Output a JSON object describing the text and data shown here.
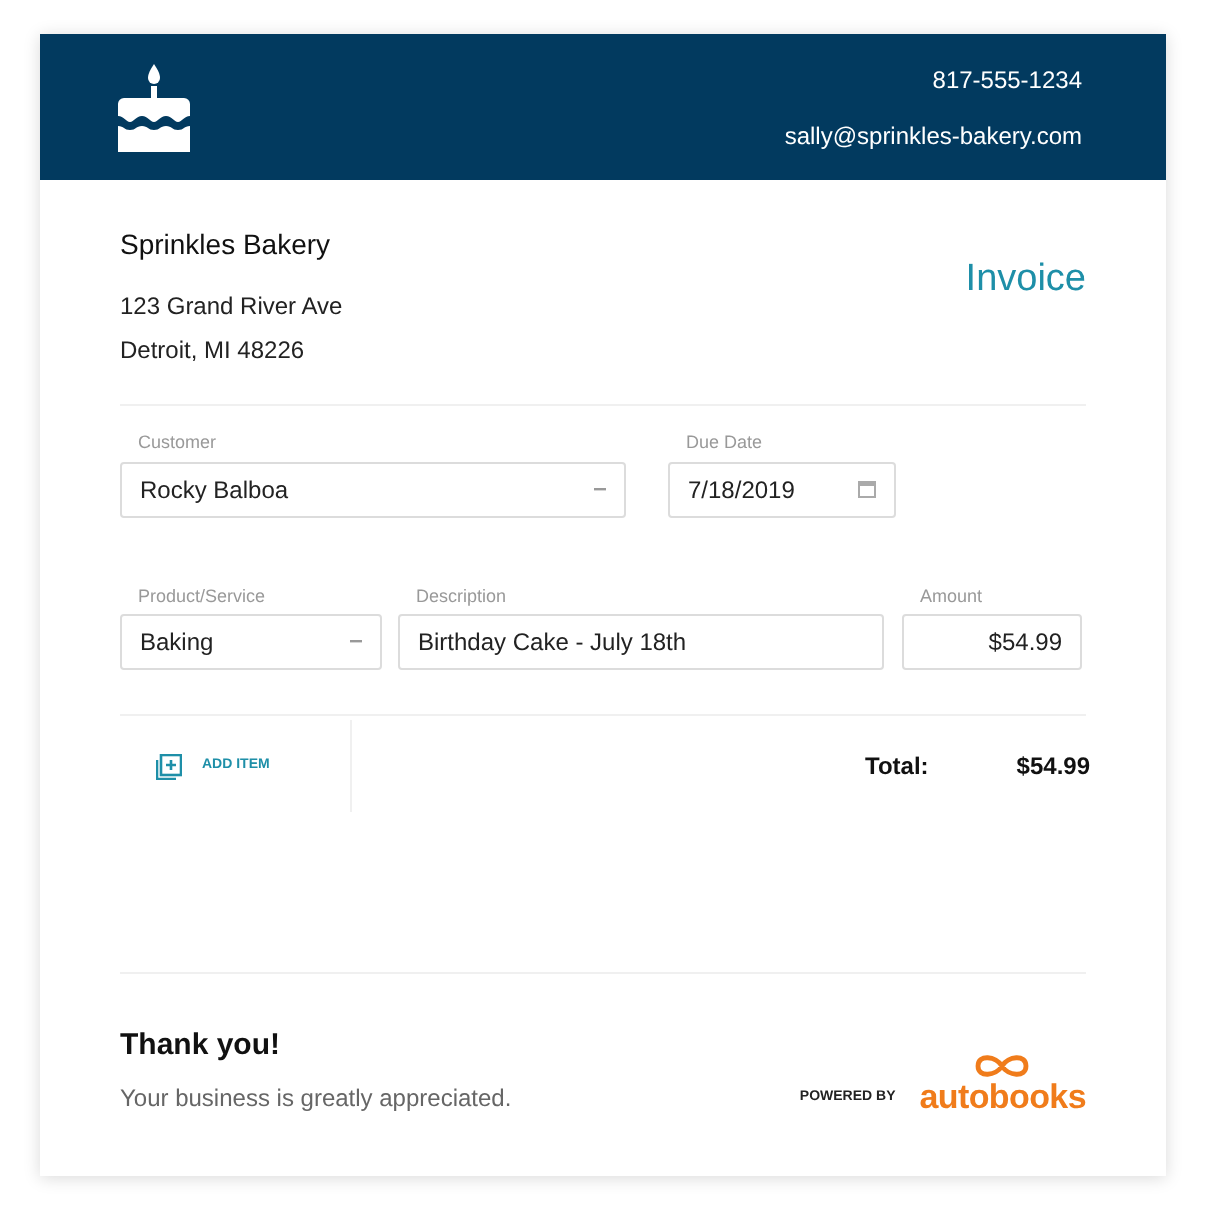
{
  "header": {
    "phone": "817-555-1234",
    "email": "sally@sprinkles-bakery.com"
  },
  "business": {
    "name": "Sprinkles Bakery",
    "address_lines": [
      "123 Grand River Ave",
      "Detroit, MI 48226"
    ]
  },
  "title": "Invoice",
  "field_rows": [
    [
      {
        "label": "Customer",
        "value": "Rocky Balboa",
        "kind": "select"
      },
      {
        "label": "Due Date",
        "value": "7/18/2019",
        "kind": "date"
      }
    ],
    [
      {
        "label": "Product/Service",
        "value": "Baking",
        "kind": "select"
      },
      {
        "label": "Description",
        "value": "Birthday Cake - July 18th",
        "kind": "text"
      },
      {
        "label": "Amount",
        "value": "$54.99",
        "kind": "amount"
      }
    ]
  ],
  "add_item": "ADD ITEM",
  "total": {
    "label": "Total:",
    "value": "$54.99"
  },
  "footer": {
    "thanks": "Thank you!",
    "message": "Your business is greatly appreciated.",
    "powered_by": "POWERED BY",
    "brand": "autobooks"
  }
}
